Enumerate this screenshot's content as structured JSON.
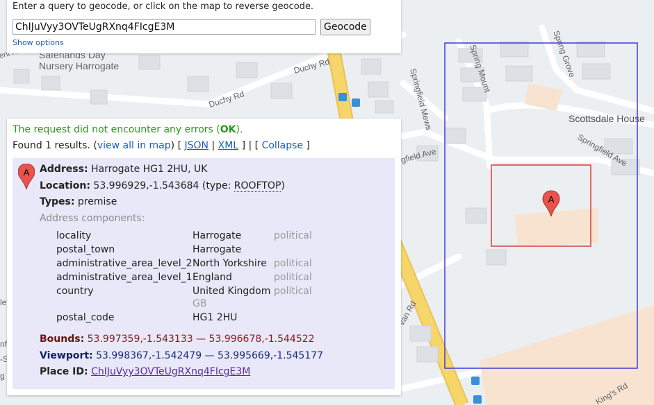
{
  "query": {
    "label": "Enter a query to geocode, or click on the map to reverse geocode.",
    "value": "ChIJuVyy3OVTeUgRXnq4FIcgE3M",
    "button": "Geocode",
    "show_options": "Show options"
  },
  "map": {
    "labels": {
      "saferlands_1": "Saferlands Day",
      "saferlands_2": "Nursery Harrogate",
      "duchy_rd_1": "Duchy Rd",
      "duchy_rd_2": "Duchy Rd",
      "springfield_mews": "Springfield Mews",
      "spring_mount": "Spring Mount",
      "spring_grove": "Spring Grove",
      "springfield_ave_1": "Springfield Ave",
      "springfield_ave_2": "gfield Ave",
      "scottsdale_house": "Scottsdale House",
      "ent_rd": "ent Rd",
      "an_rd": "van Rd",
      "kings_rd": "King's Rd",
      "edge_le": "le",
      "edge_nf": "nf",
      "edge_s": "-S",
      "edge_g": "g"
    }
  },
  "results": {
    "status_prefix": "The request did not encounter any errors (",
    "status_code": "OK",
    "status_suffix": ").",
    "found_prefix": "Found 1 results. (",
    "view_all": "view all in map",
    "sep1": ") [",
    "json": "JSON",
    "pipe": "|",
    "xml": "XML",
    "sep2": "] | [",
    "collapse": "Collapse",
    "sep3": "]",
    "result": {
      "marker_letter": "A",
      "address_label": "Address:",
      "address": "Harrogate HG1 2HU, UK",
      "location_label": "Location:",
      "location": "53.996929,-1.543684",
      "location_type_prefix": "(type:",
      "location_type": "ROOFTOP",
      "location_type_suffix": ")",
      "types_label": "Types:",
      "types": "premise",
      "components_heading": "Address components:",
      "components": [
        {
          "key": "locality",
          "value": "Harrogate",
          "type": "political",
          "extra": ""
        },
        {
          "key": "postal_town",
          "value": "Harrogate",
          "type": "",
          "extra": ""
        },
        {
          "key": "administrative_area_level_2",
          "value": "North Yorkshire",
          "type": "political",
          "extra": ""
        },
        {
          "key": "administrative_area_level_1",
          "value": "England",
          "type": "political",
          "extra": ""
        },
        {
          "key": "country",
          "value": "United Kingdom",
          "type": "political",
          "extra": "GB"
        },
        {
          "key": "postal_code",
          "value": "HG1 2HU",
          "type": "",
          "extra": ""
        }
      ],
      "bounds_label": "Bounds:",
      "bounds": "53.997359,-1.543133 — 53.996678,-1.544522",
      "viewport_label": "Viewport:",
      "viewport": "53.998367,-1.542479 — 53.995669,-1.545177",
      "place_id_label": "Place ID:",
      "place_id": "ChIJuVyy3OVTeUgRXnq4FIcgE3M"
    }
  },
  "colors": {
    "ok_green": "#2a9b1a",
    "bounds_red": "#8b1a1a",
    "viewport_blue": "#1a2a7b",
    "viewport_rect": "#3b3bd9",
    "bounds_rect": "#e03a3a",
    "marker": "#e8534b",
    "main_road": "#f6d56b"
  }
}
